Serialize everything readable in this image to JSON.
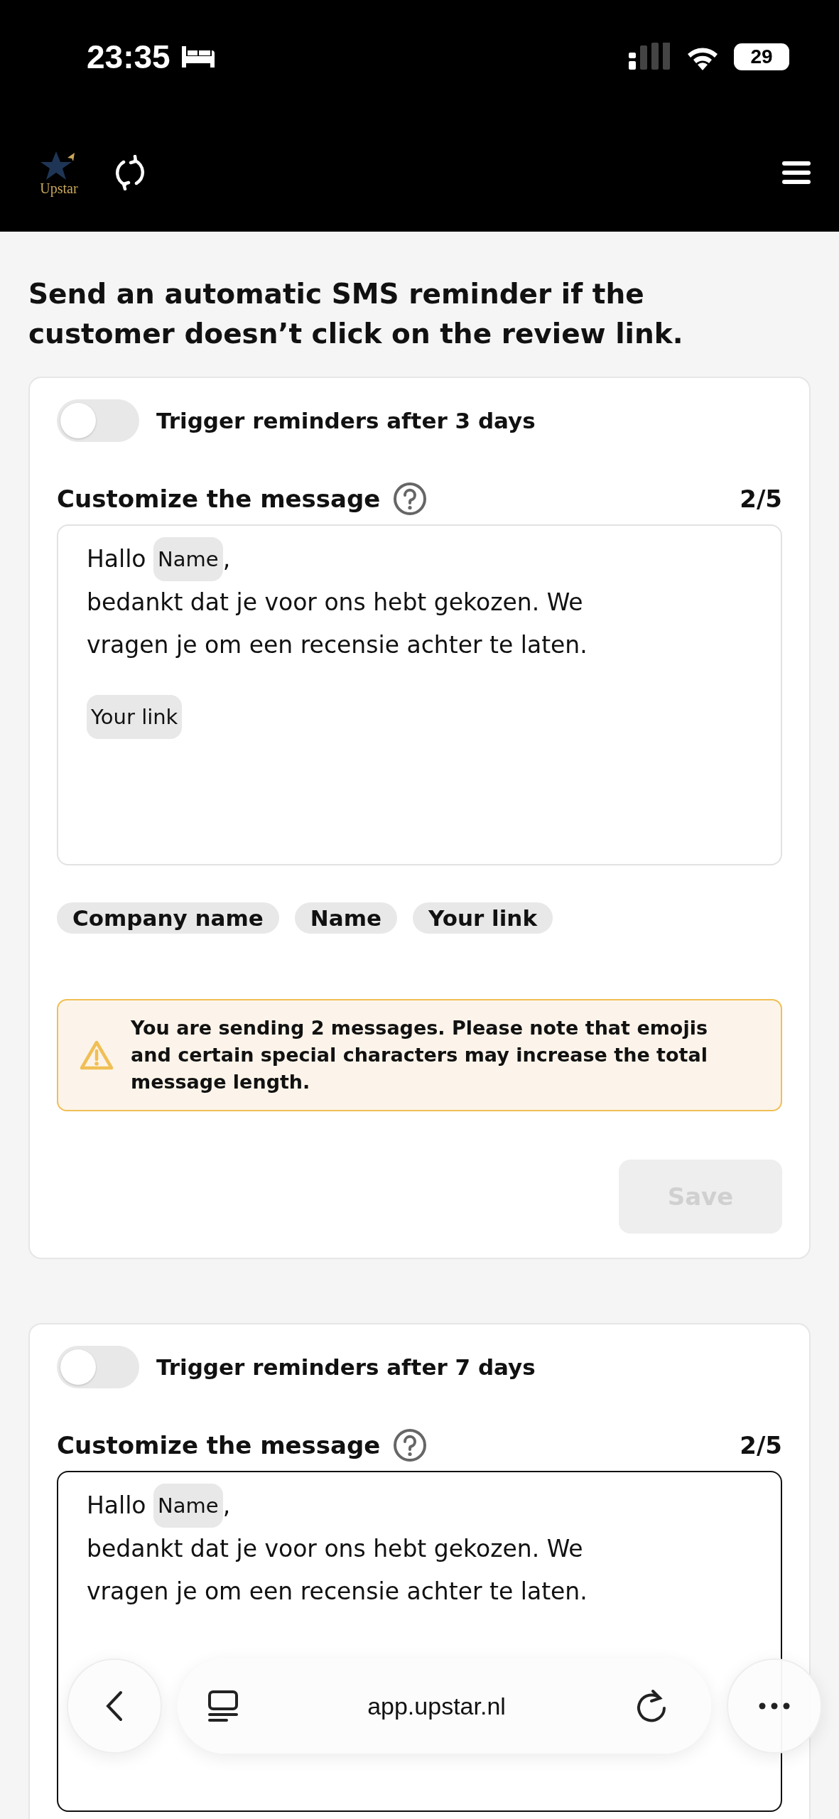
{
  "status_bar": {
    "time": "23:35",
    "battery": "29"
  },
  "header": {
    "logo_text": "Upstar"
  },
  "heading": "Send an automatic SMS reminder if the customer doesn’t click on the review link.",
  "reminders": [
    {
      "toggle_on": false,
      "label": "Trigger reminders after 3 days",
      "message_label": "Customize the message",
      "count": "2/5",
      "editor": {
        "focused": false,
        "greeting": "Hallo",
        "name_chip": "Name",
        "comma": ",",
        "body": "bedankt dat je voor ons hebt gekozen. We vragen je om een recensie achter te laten.",
        "link_chip": "Your link"
      },
      "chips": [
        "Company name",
        "Name",
        "Your link"
      ],
      "warning": "You are sending 2 messages. Please note that emojis and certain special characters may increase the total message length.",
      "save": {
        "label": "Save",
        "disabled": true
      }
    },
    {
      "toggle_on": false,
      "label": "Trigger reminders after 7 days",
      "message_label": "Customize the message",
      "count": "2/5",
      "editor": {
        "focused": true,
        "greeting": "Hallo",
        "name_chip": "Name",
        "comma": ",",
        "body": "bedankt dat je voor ons hebt gekozen. We vragen je om een recensie achter te laten."
      }
    }
  ],
  "browser_bar": {
    "url": "app.upstar.nl"
  }
}
